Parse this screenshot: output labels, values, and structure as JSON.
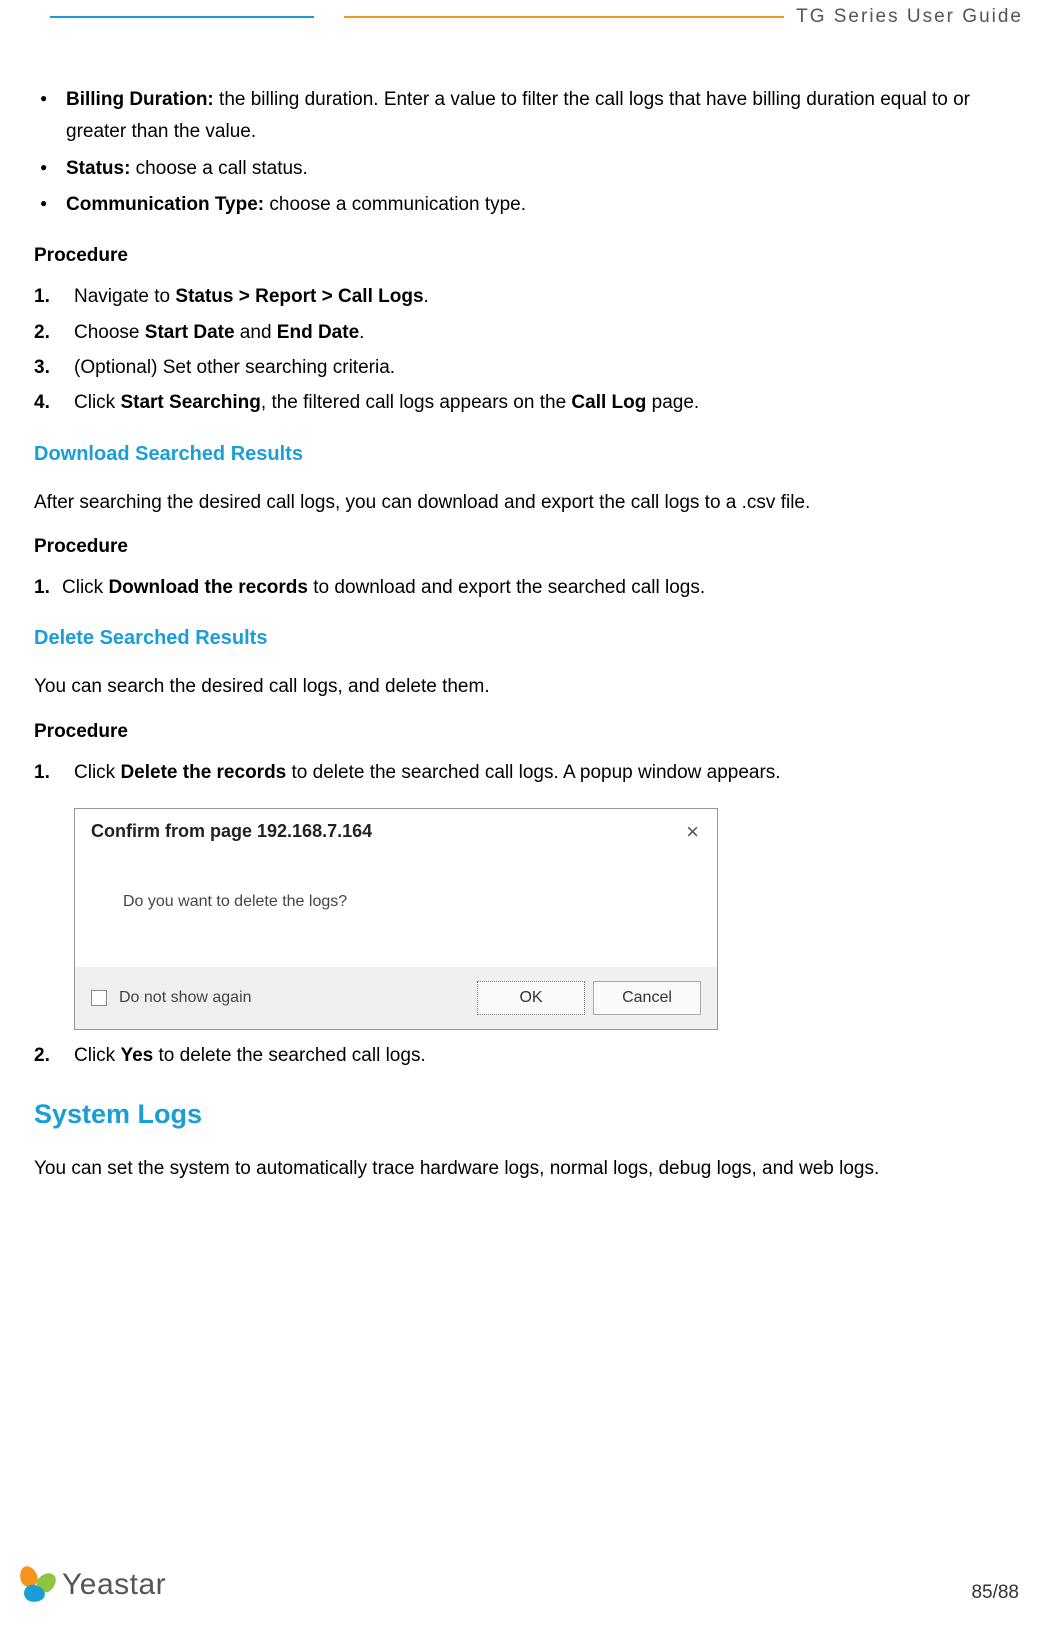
{
  "header": {
    "title": "TG  Series  User  Guide"
  },
  "bullets": {
    "b1_label": "Billing Duration:",
    "b1_text": " the billing duration. Enter a value to filter the call logs that have billing duration equal to or greater than the value.",
    "b2_label": "Status:",
    "b2_text": " choose a call status.",
    "b3_label": "Communication Type:",
    "b3_text": " choose a communication type."
  },
  "proc1": {
    "label": "Procedure",
    "s1_a": "Navigate to ",
    "s1_b": "Status > Report > Call Logs",
    "s1_c": ".",
    "s2_a": "Choose ",
    "s2_b": "Start Date",
    "s2_c": " and ",
    "s2_d": "End Date",
    "s2_e": ".",
    "s3": "(Optional) Set other searching criteria.",
    "s4_a": "Click ",
    "s4_b": "Start Searching",
    "s4_c": ", the filtered call logs appears on the ",
    "s4_d": "Call Log",
    "s4_e": " page."
  },
  "download": {
    "heading": "Download Searched Results",
    "para": "After searching the desired call logs, you can download and export the call logs to a .csv file.",
    "proc_label": "Procedure",
    "s1_a": "Click ",
    "s1_b": "Download the records",
    "s1_c": " to download and export the searched call logs."
  },
  "delete": {
    "heading": "Delete Searched Results",
    "para": "You can search the desired call logs, and delete them.",
    "proc_label": "Procedure",
    "s1_a": "Click ",
    "s1_b": "Delete the records",
    "s1_c": " to delete the searched call logs. A popup window appears.",
    "s2_a": "Click ",
    "s2_b": "Yes",
    "s2_c": " to delete the searched call logs."
  },
  "dialog": {
    "title": "Confirm from page 192.168.7.164",
    "body": "Do you want to delete the logs?",
    "checkbox_label": "Do not show again",
    "ok": "OK",
    "cancel": "Cancel"
  },
  "syslogs": {
    "heading": "System Logs",
    "para": "You can set the system to automatically trace hardware logs, normal logs, debug logs, and web logs."
  },
  "footer": {
    "brand": "Yeastar",
    "page": "85/88"
  },
  "nums": {
    "n1": "1.",
    "n2": "2.",
    "n3": "3.",
    "n4": "4."
  }
}
